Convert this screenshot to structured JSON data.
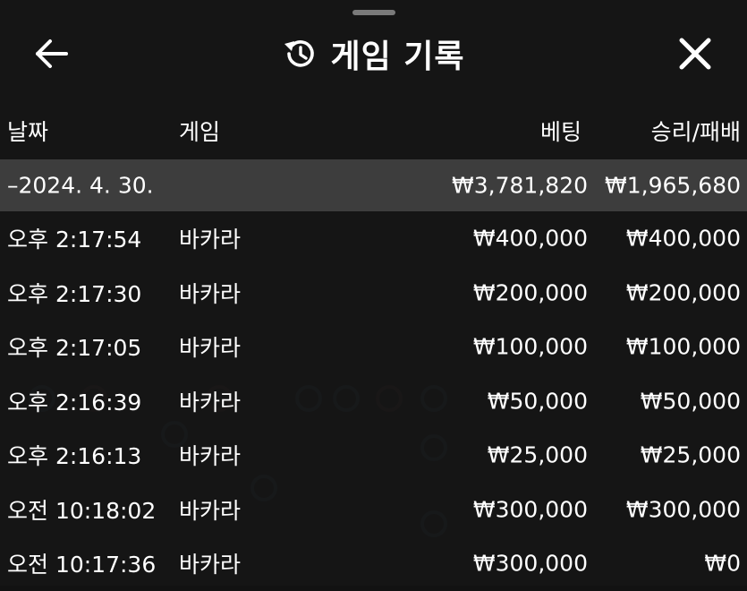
{
  "header": {
    "title": "게임 기록"
  },
  "columns": {
    "date": "날짜",
    "game": "게임",
    "bet": "베팅",
    "result": "승리/패배"
  },
  "summary": {
    "date": "–2024. 4. 30.",
    "bet": "₩3,781,820",
    "result": "₩1,965,680"
  },
  "records": [
    {
      "time": "오후 2:17:54",
      "game": "바카라",
      "bet": "₩400,000",
      "result": "₩400,000"
    },
    {
      "time": "오후 2:17:30",
      "game": "바카라",
      "bet": "₩200,000",
      "result": "₩200,000"
    },
    {
      "time": "오후 2:17:05",
      "game": "바카라",
      "bet": "₩100,000",
      "result": "₩100,000"
    },
    {
      "time": "오후 2:16:39",
      "game": "바카라",
      "bet": "₩50,000",
      "result": "₩50,000"
    },
    {
      "time": "오후 2:16:13",
      "game": "바카라",
      "bet": "₩25,000",
      "result": "₩25,000"
    },
    {
      "time": "오전 10:18:02",
      "game": "바카라",
      "bet": "₩300,000",
      "result": "₩300,000"
    },
    {
      "time": "오전 10:17:36",
      "game": "바카라",
      "bet": "₩300,000",
      "result": "₩0"
    }
  ],
  "icons": {
    "back": "arrow-left-icon",
    "history": "history-icon",
    "close": "close-icon"
  },
  "colors": {
    "background": "#161616",
    "highlight_row": "#3d3d3d",
    "text": "#ffffff"
  }
}
